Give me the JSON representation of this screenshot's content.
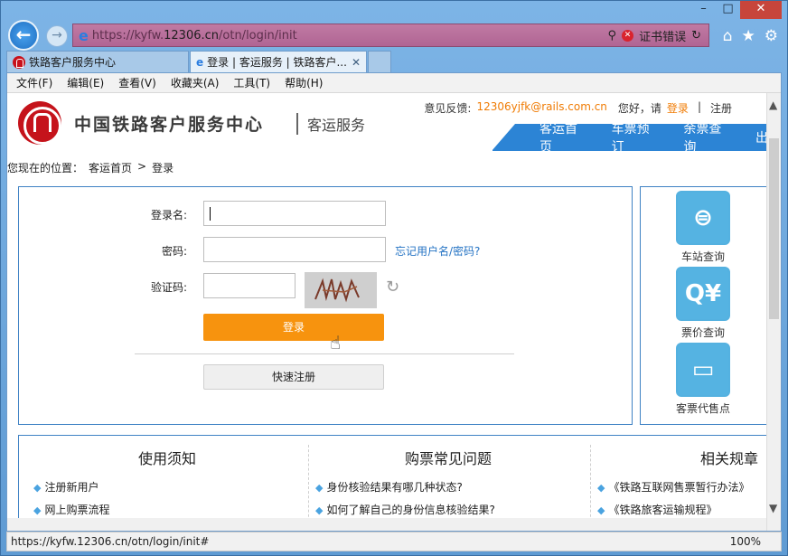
{
  "window": {
    "min": "–",
    "max": "□",
    "close": "✕"
  },
  "address": {
    "url_prefix": "https://kyfw.",
    "url_domain": "12306.cn",
    "url_path": "/otn/login/init",
    "cert_error": "证书错误"
  },
  "tabs": [
    {
      "label": "铁路客户服务中心"
    },
    {
      "label": "登录 | 客运服务 | 铁路客户..."
    }
  ],
  "menu": [
    "文件(F)",
    "编辑(E)",
    "查看(V)",
    "收藏夹(A)",
    "工具(T)",
    "帮助(H)"
  ],
  "header": {
    "site_name": "中国铁路客户服务中心",
    "site_sub": "客运服务",
    "feedback_label": "意见反馈:",
    "feedback_email": "12306yjfk@rails.com.cn",
    "greeting": "您好，请",
    "login_link": "登录",
    "sep": "|",
    "register_link": "注册",
    "nav": [
      "客运首页",
      "车票预订",
      "余票查询",
      "出"
    ]
  },
  "breadcrumb": {
    "prefix": "您现在的位置：",
    "home": "客运首页",
    "arrow": ">",
    "current": "登录"
  },
  "login_form": {
    "username_label": "登录名:",
    "password_label": "密码:",
    "forgot_link": "忘记用户名/密码?",
    "captcha_label": "验证码:",
    "login_button": "登录",
    "quick_register": "快速注册"
  },
  "sidebar": [
    {
      "label": "车站查询",
      "icon": "station-icon"
    },
    {
      "label": "票价查询",
      "icon": "price-search-icon"
    },
    {
      "label": "客票代售点",
      "icon": "ticket-agency-icon"
    }
  ],
  "info": {
    "col1": {
      "title": "使用须知",
      "items": [
        "注册新用户",
        "网上购票流程"
      ]
    },
    "col2": {
      "title": "购票常见问题",
      "items": [
        "身份核验结果有哪几种状态?",
        "如何了解自己的身份信息核验结果?"
      ]
    },
    "col3": {
      "title": "相关规章",
      "items": [
        "《铁路互联网售票暂行办法》",
        "《铁路旅客运输规程》"
      ]
    }
  },
  "status": {
    "url": "https://kyfw.12306.cn/otn/login/init#",
    "zoom": "100%"
  }
}
